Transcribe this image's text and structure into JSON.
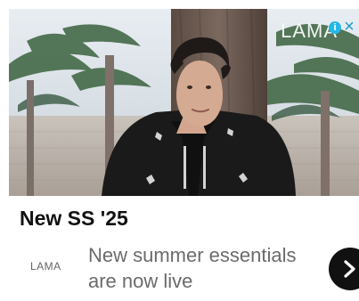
{
  "hero": {
    "brand_overlay": "LAMA",
    "adchoices_icon": "info-icon",
    "close_icon": "close-icon"
  },
  "content": {
    "headline": "New SS '25",
    "brand_logo": "LAMA",
    "description": "New summer essentials are now live",
    "next_icon": "chevron-right-icon"
  },
  "colors": {
    "headline": "#111111",
    "description": "#6b6b6b",
    "next_button": "#111111",
    "adchoices": "#25b7e8",
    "close": "#1d9bd1"
  }
}
